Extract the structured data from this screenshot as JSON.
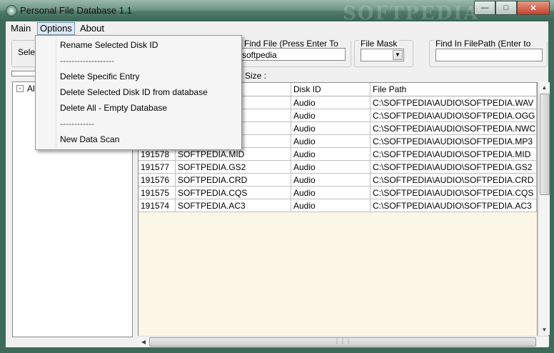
{
  "window": {
    "title": "Personal File Database 1.1",
    "watermark": "SOFTPEDIA"
  },
  "menubar": {
    "items": [
      "Main",
      "Options",
      "About"
    ]
  },
  "options_menu": {
    "items": [
      {
        "label": "Rename Selected Disk ID"
      },
      {
        "label": "-------------------"
      },
      {
        "label": "Delete Specific Entry"
      },
      {
        "label": "Delete Selected Disk ID from database"
      },
      {
        "label": "Delete All - Empty Database"
      },
      {
        "label": "------------"
      },
      {
        "label": "New Data Scan"
      }
    ]
  },
  "search": {
    "find_file_label": "Find File (Press Enter To Search)",
    "find_file_value": "softpedia",
    "file_mask_label": "File Mask",
    "file_mask_value": "",
    "find_in_path_label": "Find In FilePath (Enter to Search)",
    "find_in_path_value": ""
  },
  "left_panel": {
    "select_label": "Selec"
  },
  "status": {
    "size_label": "Size :"
  },
  "tree": {
    "root_label": "Al",
    "toggle": "-"
  },
  "grid": {
    "columns": [
      "",
      "Disk ID",
      "File Path"
    ],
    "rows": [
      {
        "id": "",
        "name": "",
        "disk": "Audio",
        "path": "C:\\SOFTPEDIA\\AUDIO\\SOFTPEDIA.WAV"
      },
      {
        "id": "",
        "name": "",
        "disk": "Audio",
        "path": "C:\\SOFTPEDIA\\AUDIO\\SOFTPEDIA.OGG"
      },
      {
        "id": "",
        "name": "",
        "disk": "Audio",
        "path": "C:\\SOFTPEDIA\\AUDIO\\SOFTPEDIA.NWC"
      },
      {
        "id": "",
        "name": "",
        "disk": "Audio",
        "path": "C:\\SOFTPEDIA\\AUDIO\\SOFTPEDIA.MP3"
      },
      {
        "id": "191578",
        "name": "SOFTPEDIA.MID",
        "disk": "Audio",
        "path": "C:\\SOFTPEDIA\\AUDIO\\SOFTPEDIA.MID"
      },
      {
        "id": "191577",
        "name": "SOFTPEDIA.GS2",
        "disk": "Audio",
        "path": "C:\\SOFTPEDIA\\AUDIO\\SOFTPEDIA.GS2"
      },
      {
        "id": "191576",
        "name": "SOFTPEDIA.CRD",
        "disk": "Audio",
        "path": "C:\\SOFTPEDIA\\AUDIO\\SOFTPEDIA.CRD"
      },
      {
        "id": "191575",
        "name": "SOFTPEDIA.CQS",
        "disk": "Audio",
        "path": "C:\\SOFTPEDIA\\AUDIO\\SOFTPEDIA.CQS"
      },
      {
        "id": "191574",
        "name": "SOFTPEDIA.AC3",
        "disk": "Audio",
        "path": "C:\\SOFTPEDIA\\AUDIO\\SOFTPEDIA.AC3"
      }
    ]
  },
  "icons": {
    "app": "disc-icon",
    "minimize": "minimize-icon",
    "maximize": "maximize-icon",
    "close": "close-icon",
    "dropdown": "chevron-down-icon"
  }
}
